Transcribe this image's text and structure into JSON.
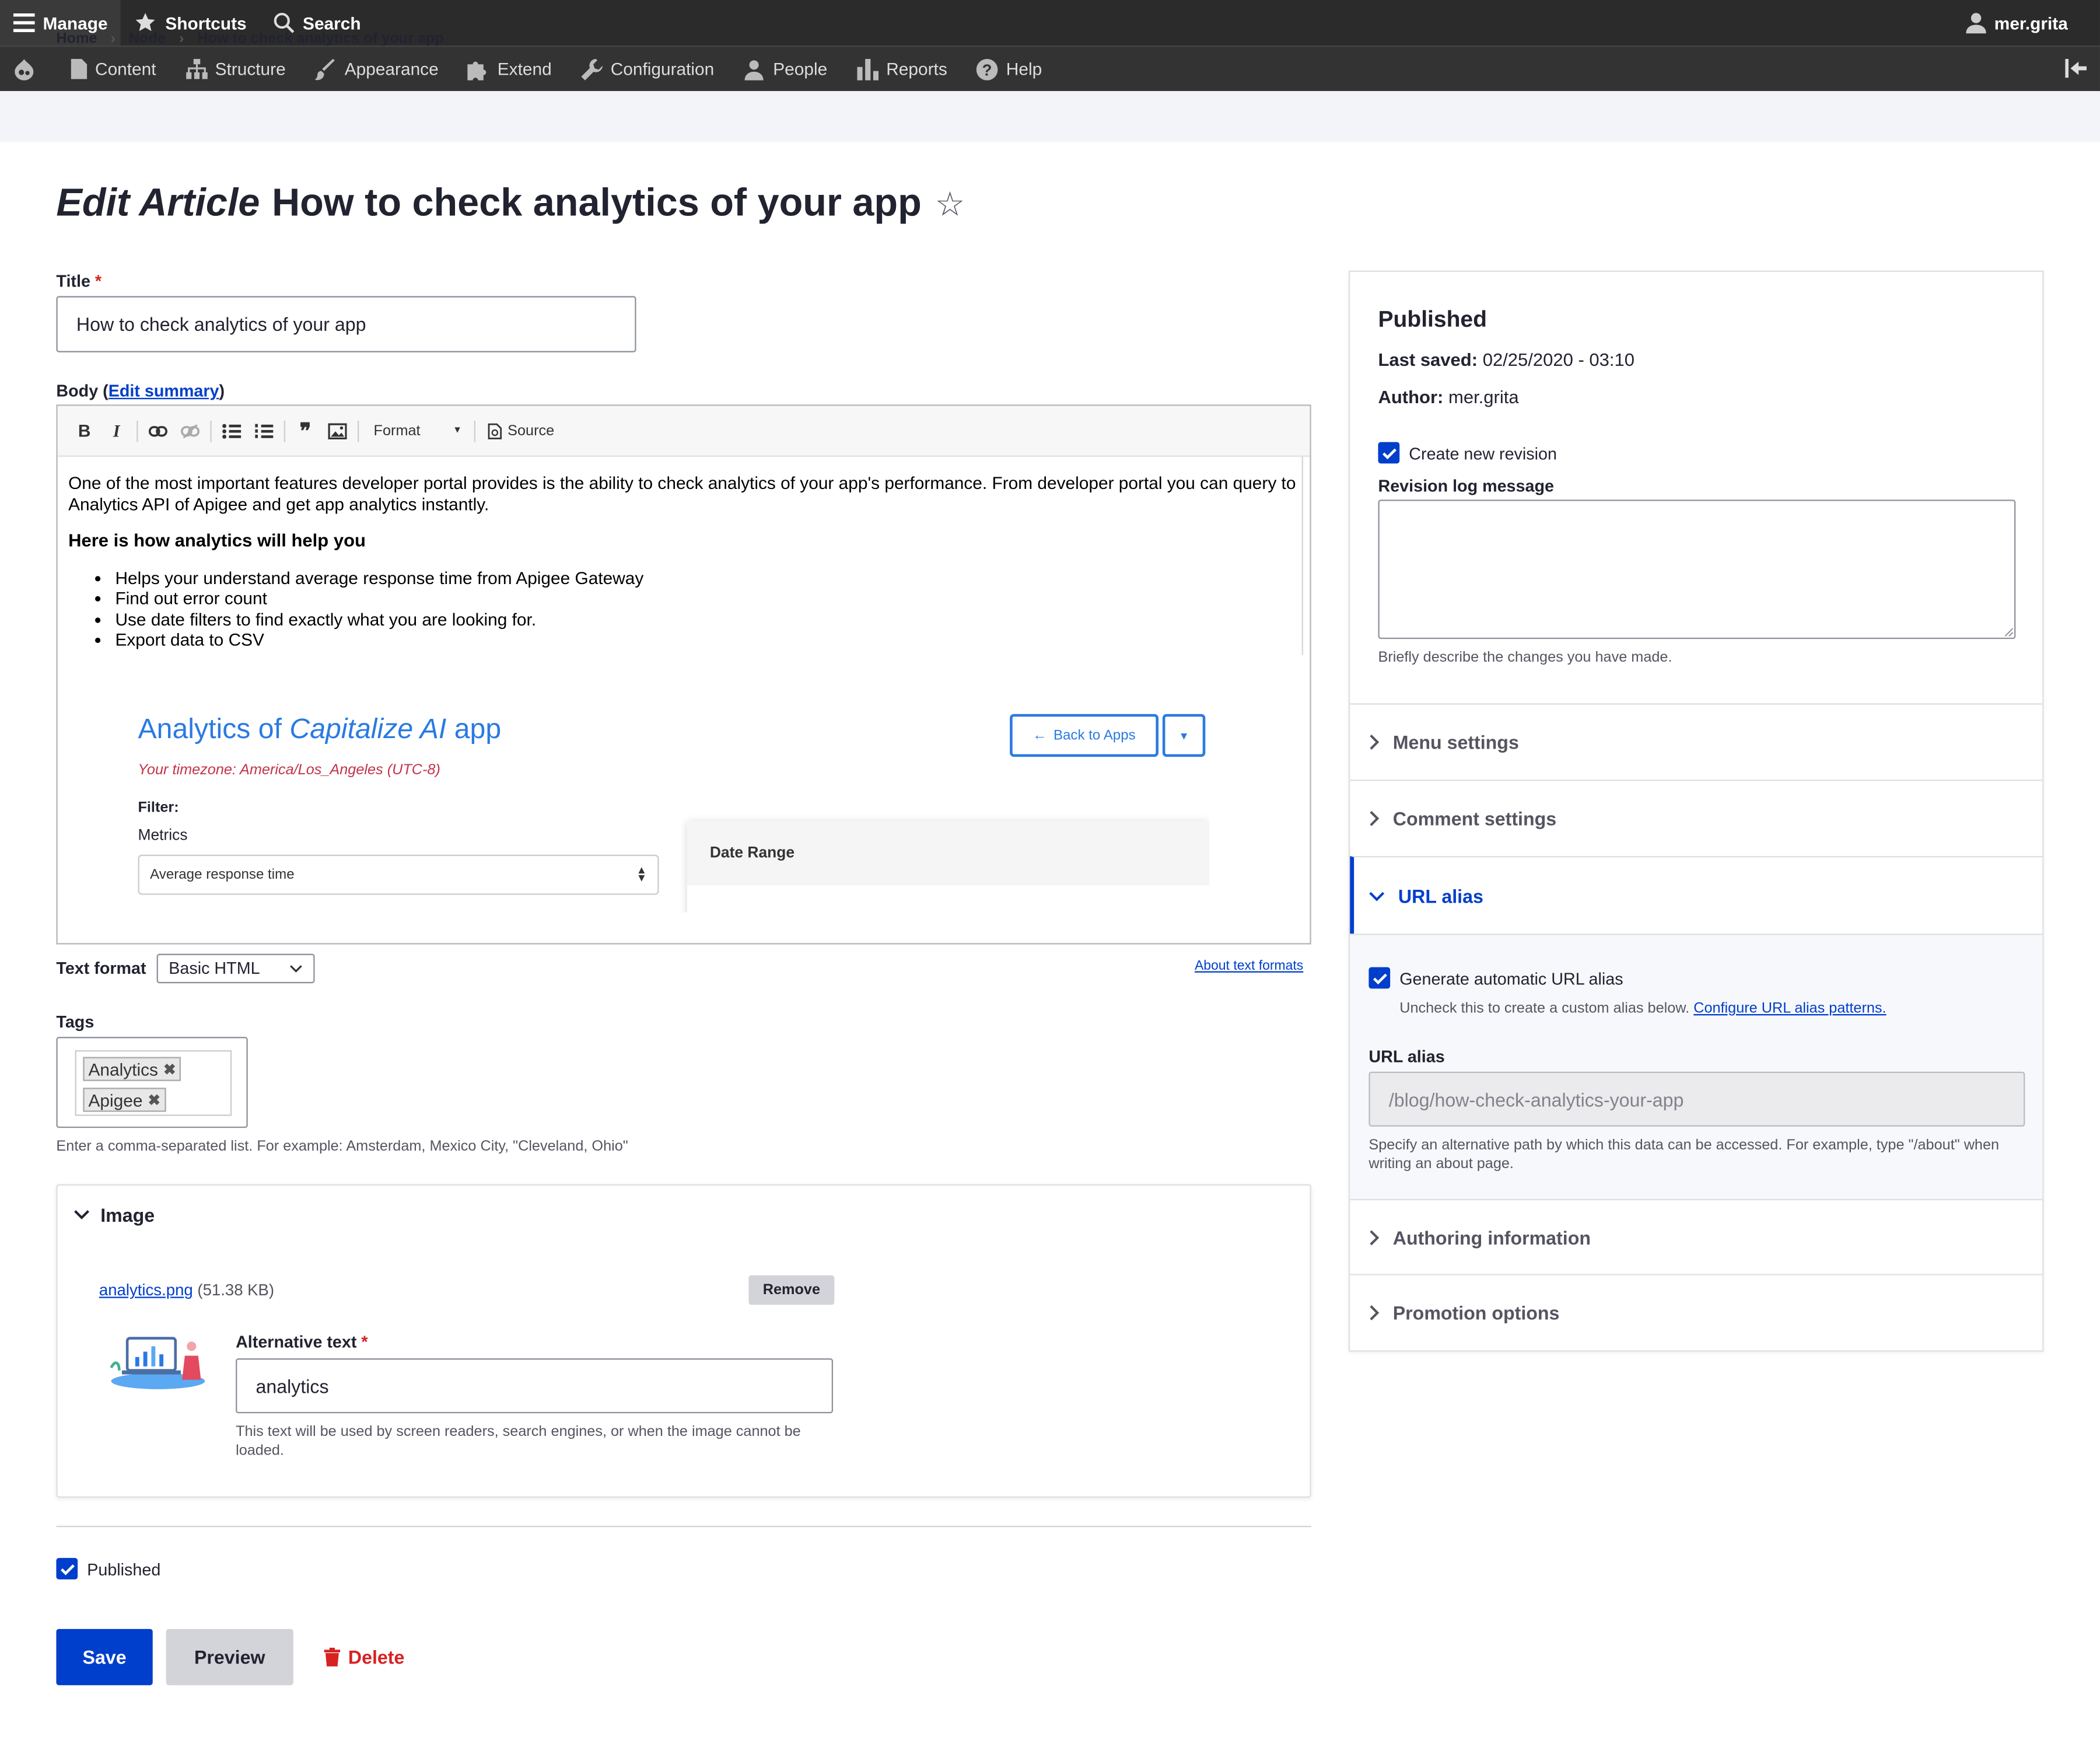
{
  "toolbar": {
    "manage": "Manage",
    "shortcuts": "Shortcuts",
    "search": "Search",
    "user": "mer.grita"
  },
  "tray": {
    "items": [
      "Content",
      "Structure",
      "Appearance",
      "Extend",
      "Configuration",
      "People",
      "Reports",
      "Help"
    ]
  },
  "breadcrumb": [
    "Home",
    "Node",
    "How to check analytics of your app"
  ],
  "breadcrumb_sep": "›",
  "page": {
    "title_prefix": "Edit Article",
    "title": "How to check analytics of your app",
    "star": "☆"
  },
  "form": {
    "title_label": "Title",
    "required_mark": "*",
    "title_value": "How to check analytics of your app",
    "body_label_prefix": "Body (",
    "body_edit_summary": "Edit summary",
    "body_label_suffix": ")",
    "editor": {
      "bold": "B",
      "italic": "I",
      "quote": "❞",
      "format_label": "Format",
      "source_label": "Source",
      "paragraph": "One of the most important features developer portal provides is the ability to check analytics of your app's performance. From developer portal you can query to Analytics API of Apigee and get app analytics instantly.",
      "heading": "Here is how analytics will help you",
      "bullets": [
        "Helps your understand average response time from Apigee Gateway",
        "Find out error count",
        "Use date filters to find exactly what you are looking for.",
        "Export data to CSV"
      ],
      "screenshot": {
        "title_prefix": "Analytics of ",
        "title_app": "Capitalize AI",
        "title_suffix": " app",
        "timezone": "Your timezone: America/Los_Angeles (UTC-8)",
        "filter": "Filter:",
        "metrics": "Metrics",
        "metric_value": "Average response time",
        "back_button": "Back to Apps",
        "date_range": "Date Range"
      }
    },
    "text_format_label": "Text format",
    "text_format_value": "Basic HTML",
    "about_text_formats": "About text formats",
    "tags_label": "Tags",
    "tags": [
      "Analytics",
      "Apigee"
    ],
    "tag_remove": "✖",
    "tags_description": "Enter a comma-separated list. For example: Amsterdam, Mexico City, \"Cleveland, Ohio\"",
    "image": {
      "heading": "Image",
      "file_name": "analytics.png",
      "file_size": "(51.38 KB)",
      "remove": "Remove",
      "alt_label": "Alternative text",
      "alt_value": "analytics",
      "alt_description": "This text will be used by screen readers, search engines, or when the image cannot be loaded."
    },
    "published_label": "Published",
    "published_checked": true,
    "save": "Save",
    "preview": "Preview",
    "delete": "Delete"
  },
  "sidebar": {
    "status": "Published",
    "last_saved_label": "Last saved:",
    "last_saved_value": "02/25/2020 - 03:10",
    "author_label": "Author:",
    "author_value": "mer.grita",
    "new_revision_label": "Create new revision",
    "revision_log_label": "Revision log message",
    "revision_log_value": "",
    "revision_log_description": "Briefly describe the changes you have made.",
    "sections": [
      "Menu settings",
      "Comment settings",
      "URL alias",
      "Authoring information",
      "Promotion options"
    ],
    "url_alias": {
      "generate_label": "Generate automatic URL alias",
      "generate_description": "Uncheck this to create a custom alias below.",
      "configure_link": "Configure URL alias patterns.",
      "field_label": "URL alias",
      "field_value": "/blog/how-check-analytics-your-app",
      "field_description": "Specify an alternative path by which this data can be accessed. For example, type \"/about\" when writing an about page."
    }
  },
  "colors": {
    "toolbar_bg": "#2b2b2b",
    "accent": "#003ecc",
    "danger": "#d72222",
    "screenshot_blue": "#2a7ae2"
  }
}
